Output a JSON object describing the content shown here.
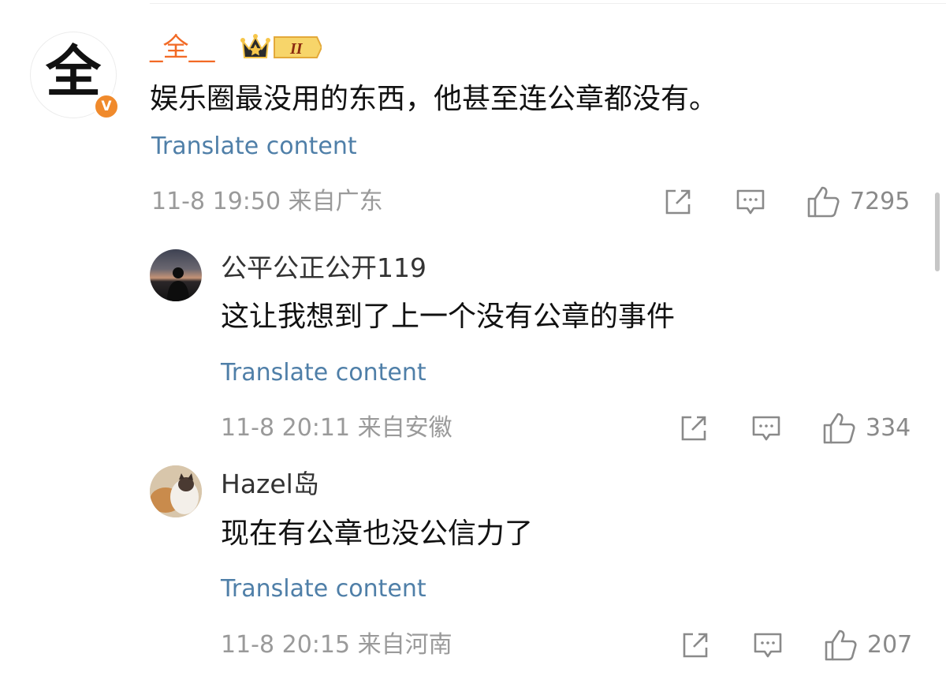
{
  "main_comment": {
    "username": "_全__",
    "avatar_text": "全",
    "verified_badge": "V",
    "crown_level": "II",
    "text": "娱乐圈最没用的东西，他甚至连公章都没有。",
    "translate_label": "Translate content",
    "timestamp": "11-8 19:50 来自广东",
    "likes": "7295"
  },
  "replies": [
    {
      "username": "公平公正公开119",
      "text": "这让我想到了上一个没有公章的事件",
      "translate_label": "Translate content",
      "timestamp": "11-8 20:11 来自安徽",
      "likes": "334"
    },
    {
      "username": "Hazel岛",
      "text": "现在有公章也没公信力了",
      "translate_label": "Translate content",
      "timestamp": "11-8 20:15 来自河南",
      "likes": "207"
    }
  ],
  "icons": {
    "share": "share-icon",
    "reply": "comment-icon",
    "like": "thumbs-up-icon",
    "verified": "verified-icon",
    "crown": "crown-icon"
  },
  "colors": {
    "username_vip": "#f26a25",
    "link": "#4f7fa8",
    "meta": "#9a9a9a",
    "badge": "#f08a2c",
    "crown_gold": "#f6c64a"
  }
}
